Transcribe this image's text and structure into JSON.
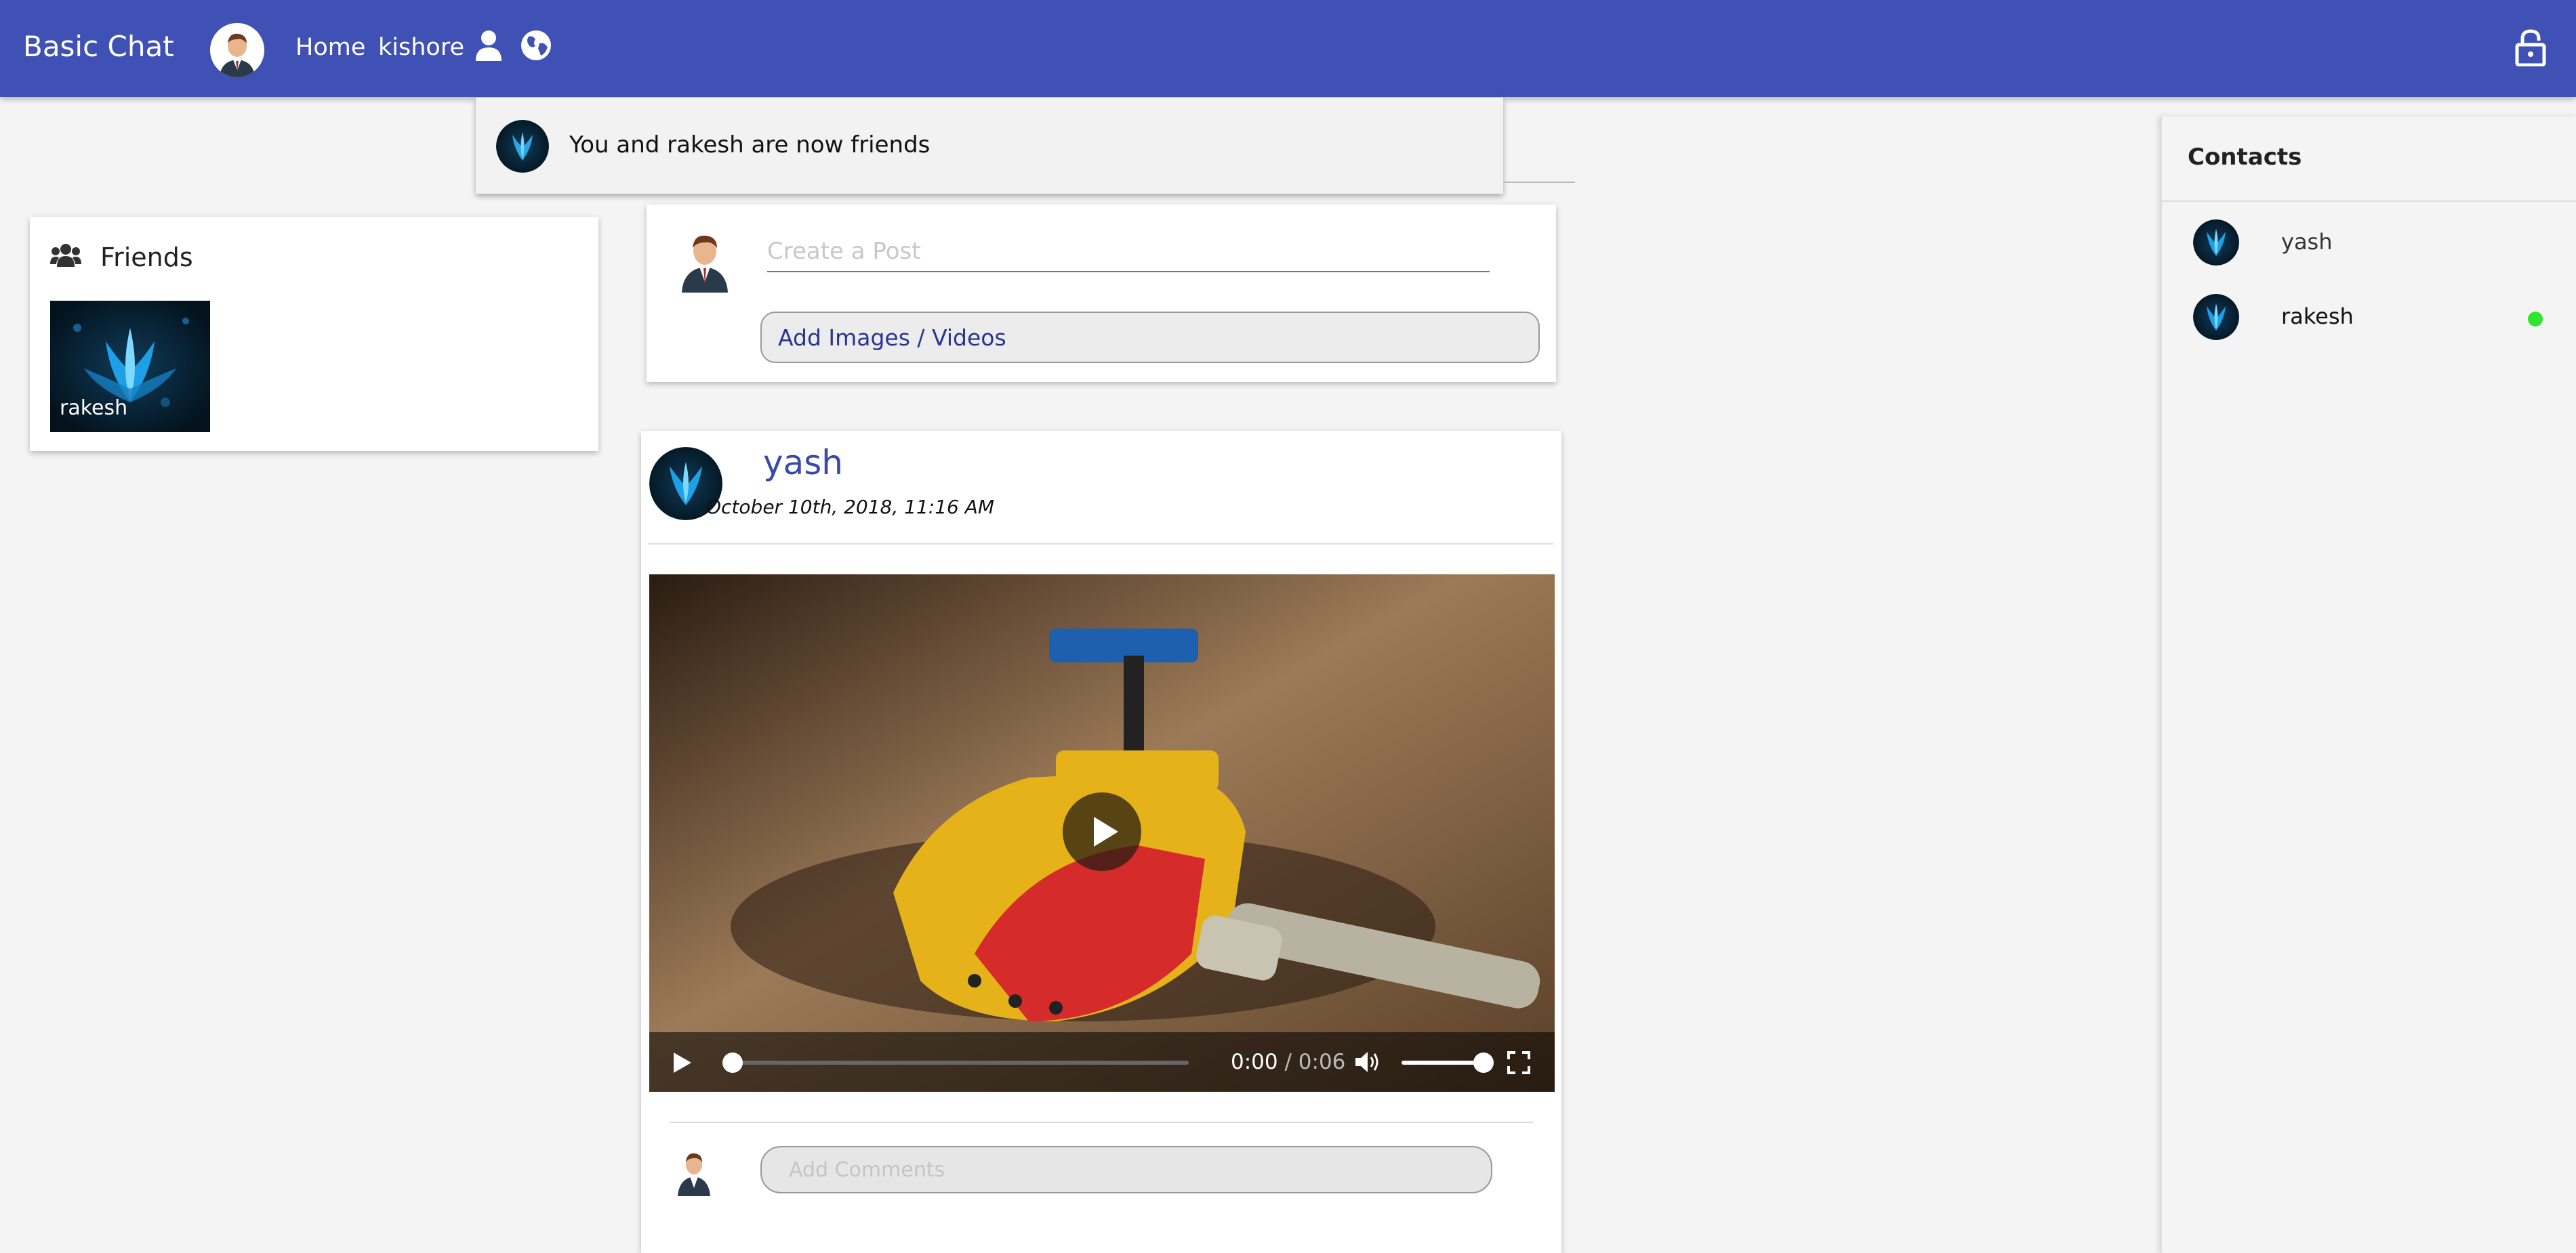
{
  "navbar": {
    "brand": "Basic Chat",
    "links": {
      "home": "Home",
      "user": "kishore"
    }
  },
  "notification": {
    "text": "You and rakesh are now friends"
  },
  "friends": {
    "title": "Friends",
    "items": [
      {
        "name": "rakesh"
      }
    ]
  },
  "create_post": {
    "placeholder": "Create a Post",
    "add_media_label": "Add Images / Videos"
  },
  "post": {
    "author": "yash",
    "date": "October 10th, 2018, 11:16 AM",
    "video": {
      "current_time": "0:00",
      "separator": " / ",
      "duration": "0:06",
      "progress": 0.0,
      "volume": 1.0
    },
    "comment_placeholder": "Add Comments"
  },
  "contacts": {
    "title": "Contacts",
    "items": [
      {
        "name": "yash",
        "online": false
      },
      {
        "name": "rakesh",
        "online": true
      }
    ]
  },
  "colors": {
    "navbar": "#3f51b5",
    "link": "#3949ab",
    "online": "#2ee62e"
  }
}
